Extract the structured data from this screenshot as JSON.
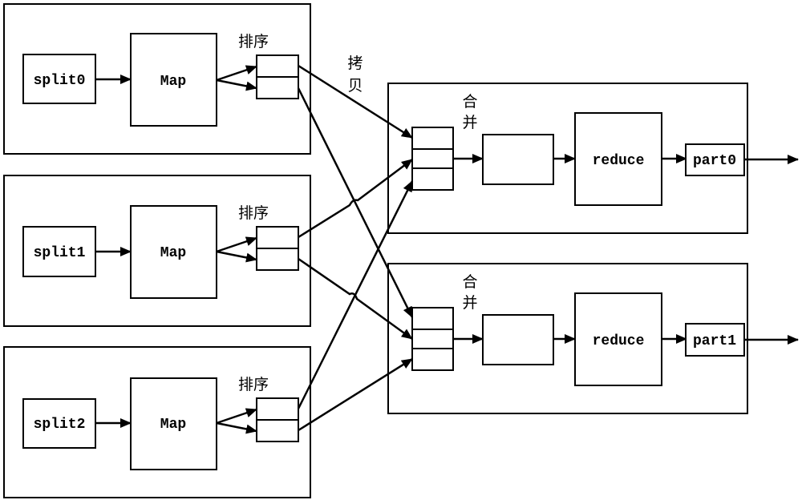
{
  "colors": {
    "stroke": "#000000",
    "background": "#ffffff"
  },
  "map_stage": [
    {
      "split": "split0",
      "map": "Map",
      "sort_label": "排序"
    },
    {
      "split": "split1",
      "map": "Map",
      "sort_label": "排序"
    },
    {
      "split": "split2",
      "map": "Map",
      "sort_label": "排序"
    }
  ],
  "copy_label": {
    "line1": "拷",
    "line2": "贝"
  },
  "reduce_stage": [
    {
      "merge_label_1": "合",
      "merge_label_2": "并",
      "reduce": "reduce",
      "output": "part0"
    },
    {
      "merge_label_1": "合",
      "merge_label_2": "并",
      "reduce": "reduce",
      "output": "part1"
    }
  ]
}
